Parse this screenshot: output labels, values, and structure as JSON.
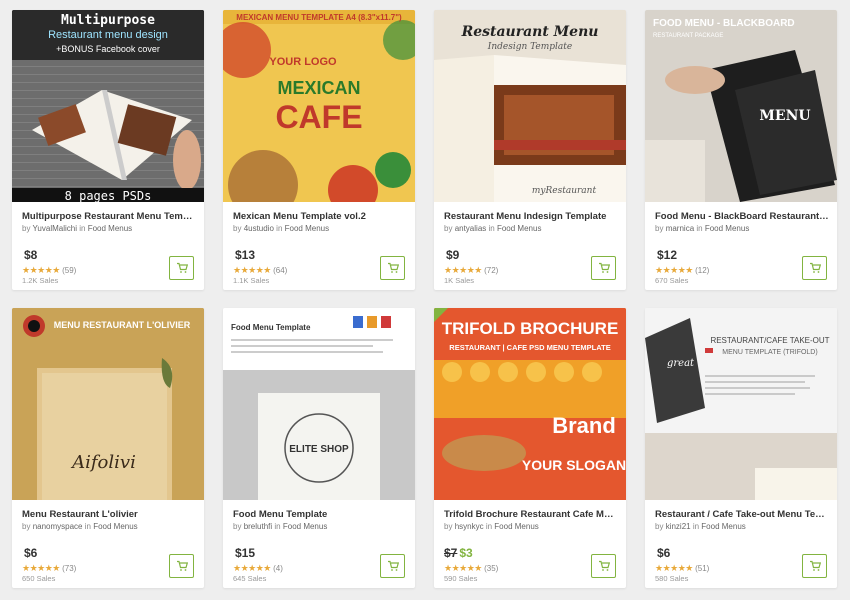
{
  "products": [
    {
      "title": "Multipurpose Restaurant Menu Template",
      "author": "YuvalMalichi",
      "category": "Food Menus",
      "price": "$8",
      "old_price": "",
      "rating_count": "(59)",
      "sales": "1.2K Sales",
      "stars": "★★★★★",
      "thumb_text": {
        "line1": "Multipurpose",
        "line2": "Restaurant menu design",
        "line3": "+BONUS Facebook cover",
        "line4": "8 pages PSDs"
      }
    },
    {
      "title": "Mexican Menu Template vol.2",
      "author": "4ustudio",
      "category": "Food Menus",
      "price": "$13",
      "old_price": "",
      "rating_count": "(64)",
      "sales": "1.1K Sales",
      "stars": "★★★★★",
      "thumb_text": {
        "line1": "MEXICAN MENU TEMPLATE A4 (8.3\"x11.7\")",
        "line2": "YOUR LOGO",
        "line3": "MEXICAN",
        "line4": "CAFE"
      }
    },
    {
      "title": "Restaurant Menu Indesign Template",
      "author": "antyalias",
      "category": "Food Menus",
      "price": "$9",
      "old_price": "",
      "rating_count": "(72)",
      "sales": "1K Sales",
      "stars": "★★★★★",
      "thumb_text": {
        "line1": "Restaurant Menu",
        "line2": "Indesign Template",
        "line3": "myRestaurant"
      }
    },
    {
      "title": "Food Menu - BlackBoard Restaurant Package",
      "author": "marnica",
      "category": "Food Menus",
      "price": "$12",
      "old_price": "",
      "rating_count": "(12)",
      "sales": "670 Sales",
      "stars": "★★★★★",
      "thumb_text": {
        "line1": "FOOD MENU - BLACKBOARD",
        "line2": "RESTAURANT PACKAGE",
        "line3": "MENU"
      }
    },
    {
      "title": "Menu Restaurant L'olivier",
      "author": "nanomyspace",
      "category": "Food Menus",
      "price": "$6",
      "old_price": "",
      "rating_count": "(73)",
      "sales": "650 Sales",
      "stars": "★★★★★",
      "thumb_text": {
        "line1": "MENU RESTAURANT L'OLIVIER",
        "line2": "Aifolivi"
      }
    },
    {
      "title": "Food Menu Template",
      "author": "breluthfi",
      "category": "Food Menus",
      "price": "$15",
      "old_price": "",
      "rating_count": "(4)",
      "sales": "645 Sales",
      "stars": "★★★★★",
      "thumb_text": {
        "line1": "Food Menu Template",
        "line2": "ELITE SHOP"
      }
    },
    {
      "title": "Trifold Brochure Restaurant Cafe Menu Template",
      "author": "hsynkyc",
      "category": "Food Menus",
      "price": "$3",
      "old_price": "$7",
      "rating_count": "(35)",
      "sales": "590 Sales",
      "stars": "★★★★★",
      "thumb_text": {
        "line1": "TRIFOLD BROCHURE",
        "line2": "RESTAURANT | CAFE PSD MENU TEMPLATE",
        "line3": "Brand",
        "line4": "YOUR SLOGAN"
      }
    },
    {
      "title": "Restaurant / Cafe Take-out Menu Template",
      "author": "kinzi21",
      "category": "Food Menus",
      "price": "$6",
      "old_price": "",
      "rating_count": "(51)",
      "sales": "580 Sales",
      "stars": "★★★★★",
      "thumb_text": {
        "line1": "RESTAURANT/CAFE TAKE-OUT",
        "line2": "MENU TEMPLATE (TRIFOLD)",
        "line3": "great"
      }
    }
  ],
  "labels": {
    "by": "by",
    "in": "in"
  },
  "icons": {
    "cart": "cart-icon"
  },
  "colors": {
    "accent": "#82b440",
    "star": "#e8a93a"
  }
}
